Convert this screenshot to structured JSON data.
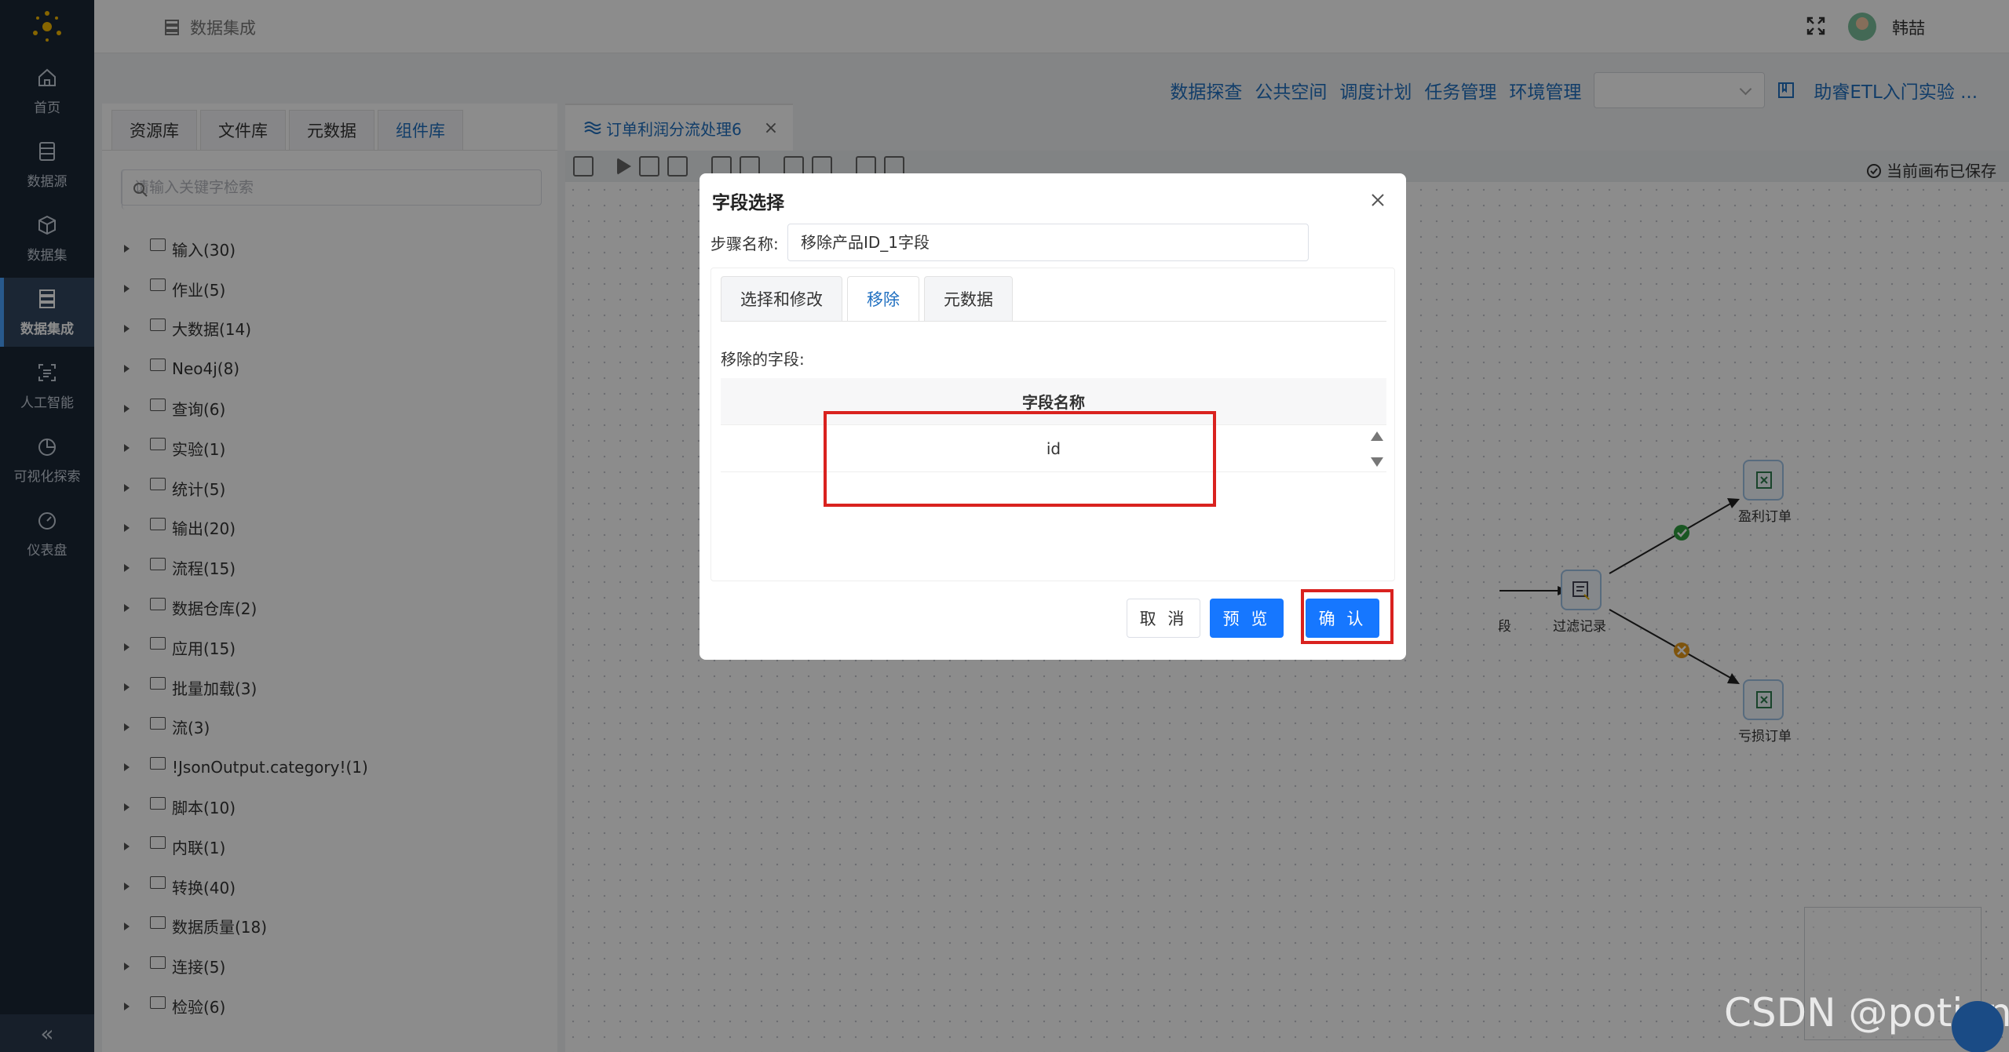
{
  "nav": {
    "items": [
      {
        "label": "首页",
        "icon": "home-icon"
      },
      {
        "label": "数据源",
        "icon": "database-icon"
      },
      {
        "label": "数据集",
        "icon": "cube-icon"
      },
      {
        "label": "数据集成",
        "icon": "server-icon",
        "active": true
      },
      {
        "label": "人工智能",
        "icon": "ai-scan-icon"
      },
      {
        "label": "可视化探索",
        "icon": "pie-chart-icon"
      },
      {
        "label": "仪表盘",
        "icon": "gauge-icon"
      }
    ],
    "collapse": "«"
  },
  "header": {
    "breadcrumb": "数据集成",
    "username": "韩喆"
  },
  "menu": {
    "items": [
      "数据探查",
      "公共空间",
      "调度计划",
      "任务管理",
      "环境管理"
    ],
    "environment_select": "",
    "help_link": "助睿ETL入门实验 ..."
  },
  "left_panel": {
    "tabs": [
      "资源库",
      "文件库",
      "元数据",
      "组件库"
    ],
    "active_tab": "组件库",
    "search_placeholder": "请输入关键字检索",
    "tree": [
      "输入(30)",
      "作业(5)",
      "大数据(14)",
      "Neo4j(8)",
      "查询(6)",
      "实验(1)",
      "统计(5)",
      "输出(20)",
      "流程(15)",
      "数据仓库(2)",
      "应用(15)",
      "批量加载(3)",
      "流(3)",
      "!JsonOutput.category!(1)",
      "脚本(10)",
      "内联(1)",
      "转换(40)",
      "数据质量(18)",
      "连接(5)",
      "检验(6)"
    ]
  },
  "canvas": {
    "tab_title": "订单利润分流处理6",
    "status": "当前画布已保存",
    "nodes": {
      "filter": "过滤记录",
      "profit": "盈利订单",
      "loss": "亏损订单",
      "partial_left": "段"
    }
  },
  "dialog": {
    "title": "字段选择",
    "step_label": "步骤名称:",
    "step_value": "移除产品ID_1字段",
    "tabs": [
      "选择和修改",
      "移除",
      "元数据"
    ],
    "active_tab": "移除",
    "removed_label": "移除的字段:",
    "column_header": "字段名称",
    "rows": [
      "id"
    ],
    "buttons": {
      "cancel": "取 消",
      "preview": "预 览",
      "confirm": "确 认"
    }
  },
  "watermark": "CSDN @potion()",
  "colors": {
    "primary": "#1677ff",
    "link": "#1f6fc0",
    "nav_bg": "#1b2736",
    "highlight": "#d9221f"
  }
}
